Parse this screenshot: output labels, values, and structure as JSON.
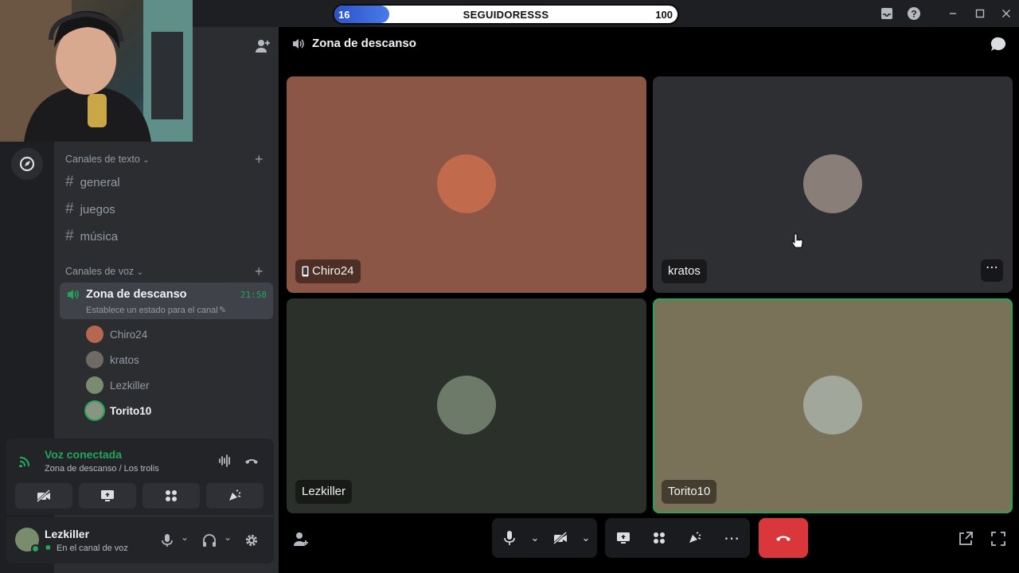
{
  "follower_goal": {
    "current": "16",
    "label": "SEGUIDORESSS",
    "goal": "100",
    "progress_fraction": 0.16
  },
  "sidebar": {
    "text_category": "Canales de texto",
    "text_channels": [
      {
        "label": "general"
      },
      {
        "label": "juegos"
      },
      {
        "label": "música"
      }
    ],
    "voice_category": "Canales de voz",
    "voice_channel": {
      "label": "Zona de descanso",
      "time": "21:58",
      "status_placeholder": "Establece un estado para el canal"
    },
    "members": [
      {
        "name": "Chiro24",
        "color": "#b5674f"
      },
      {
        "name": "kratos",
        "color": "#6f6a66"
      },
      {
        "name": "Lezkiller",
        "color": "#7a8c6e"
      },
      {
        "name": "Torito10",
        "color": "#8a9482"
      }
    ]
  },
  "voice_panel": {
    "status": "Voz conectada",
    "location": "Zona de descanso / Los trolis",
    "status_color": "#23a55a"
  },
  "user_panel": {
    "username": "Lezkiller",
    "status": "En el canal de voz"
  },
  "header": {
    "channel_name": "Zona de descanso"
  },
  "tiles": [
    {
      "name": "Chiro24",
      "bg": "#8c5646",
      "avatar": "#c26a4c",
      "mobile": true,
      "speaking": false
    },
    {
      "name": "kratos",
      "bg": "#2e2f33",
      "avatar": "#8a7f78",
      "mobile": false,
      "speaking": false
    },
    {
      "name": "Lezkiller",
      "bg": "#2b302b",
      "avatar": "#6d7a6a",
      "mobile": false,
      "speaking": false
    },
    {
      "name": "Torito10",
      "bg": "#7a7258",
      "avatar": "#a1a79a",
      "mobile": false,
      "speaking": true
    }
  ],
  "colors": {
    "accent_green": "#23a55a",
    "danger_red": "#da373c"
  }
}
